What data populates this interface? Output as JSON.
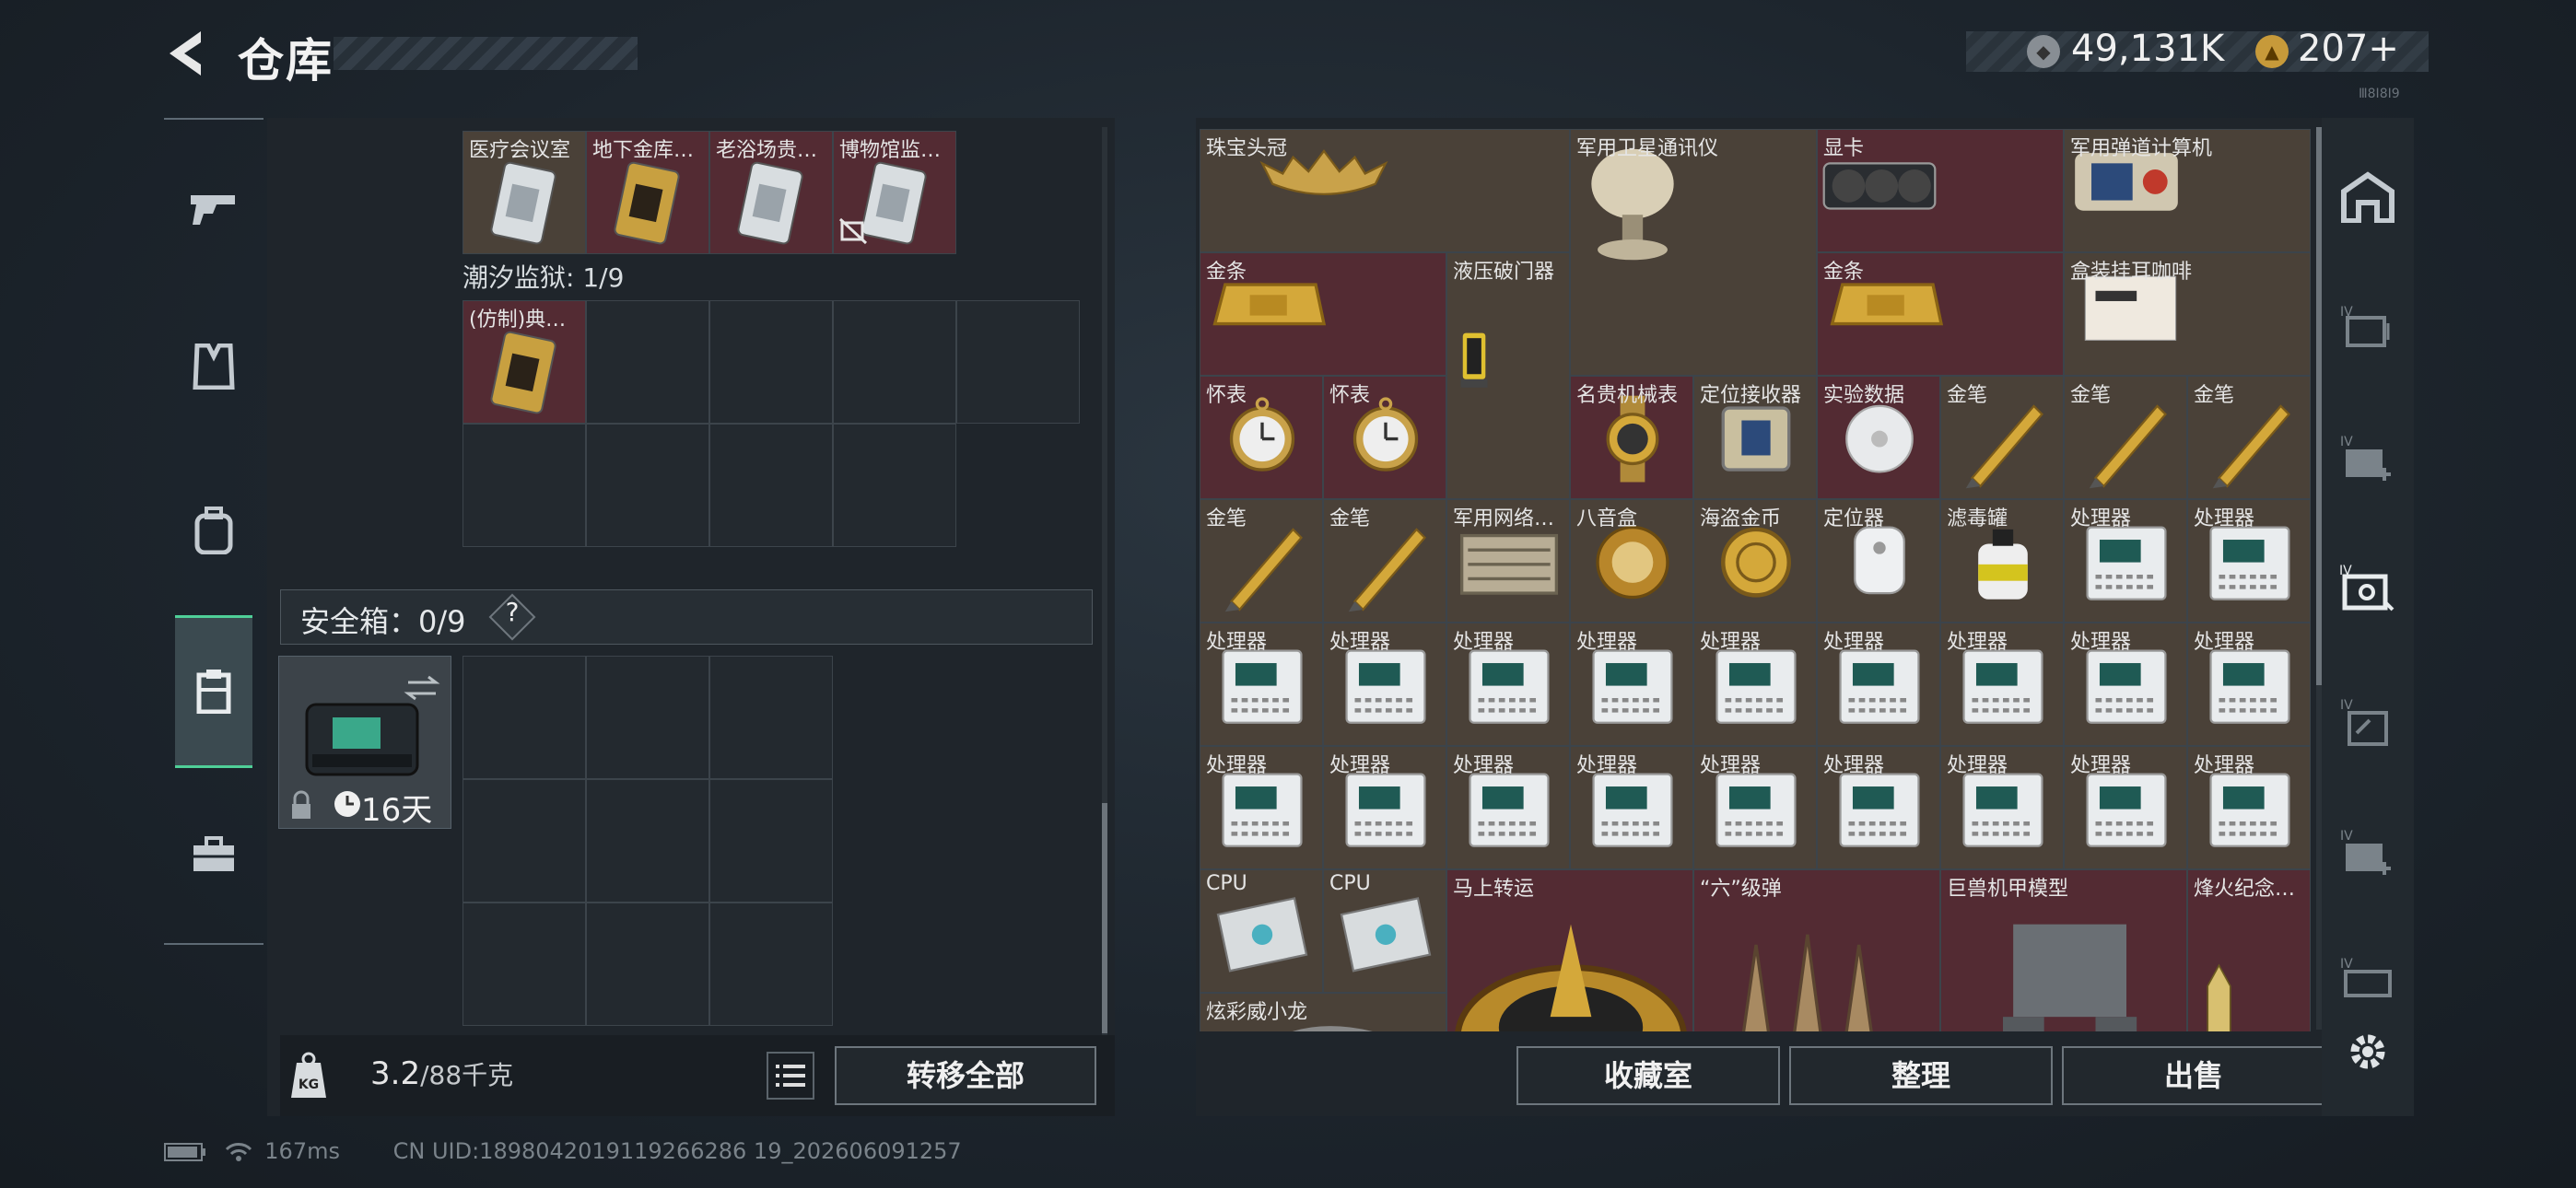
{
  "header": {
    "title": "仓库",
    "money": "49,131K",
    "gold": "207",
    "gold_plus": "+",
    "version": "Ⅲ8Ⅰ8Ⅰ9"
  },
  "left_nav": [
    "gun-icon",
    "vest-icon",
    "backpack-icon",
    "container-icon",
    "toolbox-icon"
  ],
  "top_row": [
    {
      "label": "医疗会议室",
      "color": "tan",
      "icon": "white-card-icon"
    },
    {
      "label": "地下金库…",
      "color": "red",
      "icon": "gold-card-icon"
    },
    {
      "label": "老浴场贵…",
      "color": "red",
      "icon": "white-card-icon"
    },
    {
      "label": "博物馆监…",
      "color": "red",
      "icon": "white-card-icon"
    }
  ],
  "tide": {
    "label": "潮汐监狱: 1/9",
    "item": "(仿制)典…"
  },
  "safe": {
    "label": "安全箱：0/9",
    "help": "?",
    "days": "16天"
  },
  "weight": {
    "current": "3.2",
    "max": "/88千克"
  },
  "buttons": {
    "transfer": "转移全部",
    "collection": "收藏室",
    "sort": "整理",
    "sell": "出售"
  },
  "status": {
    "ping": "167ms",
    "uid": "CN UID:1898042019119266286 19_202606091257"
  },
  "grid_items": [
    {
      "label": "珠宝头冠",
      "col": 0,
      "row": 0,
      "w": 3,
      "h": 1,
      "color": "tan",
      "icon": "crown"
    },
    {
      "label": "军用卫星通讯仪",
      "col": 3,
      "row": 0,
      "w": 2,
      "h": 2,
      "color": "tan",
      "icon": "satellite"
    },
    {
      "label": "显卡",
      "col": 5,
      "row": 0,
      "w": 2,
      "h": 1,
      "color": "red",
      "icon": "gpu"
    },
    {
      "label": "军用弹道计算机",
      "col": 7,
      "row": 0,
      "w": 2,
      "h": 1,
      "color": "tan",
      "icon": "computer"
    },
    {
      "label": "金条",
      "col": 0,
      "row": 1,
      "w": 2,
      "h": 1,
      "color": "red",
      "icon": "gold-bar"
    },
    {
      "label": "液压破门器",
      "col": 2,
      "row": 1,
      "w": 1,
      "h": 2,
      "color": "tan",
      "icon": "hydraulic"
    },
    {
      "label": "金条",
      "col": 5,
      "row": 1,
      "w": 2,
      "h": 1,
      "color": "red",
      "icon": "gold-bar"
    },
    {
      "label": "盒装挂耳咖啡",
      "col": 7,
      "row": 1,
      "w": 2,
      "h": 1,
      "color": "tan",
      "icon": "coffee"
    },
    {
      "label": "怀表",
      "col": 0,
      "row": 2,
      "w": 1,
      "h": 1,
      "color": "red",
      "icon": "watch"
    },
    {
      "label": "怀表",
      "col": 1,
      "row": 2,
      "w": 1,
      "h": 1,
      "color": "red",
      "icon": "watch"
    },
    {
      "label": "名贵机械表",
      "col": 3,
      "row": 2,
      "w": 1,
      "h": 1,
      "color": "red",
      "icon": "wristwatch"
    },
    {
      "label": "定位接收器",
      "col": 4,
      "row": 2,
      "w": 1,
      "h": 1,
      "color": "tan",
      "icon": "receiver"
    },
    {
      "label": "实验数据",
      "col": 5,
      "row": 2,
      "w": 1,
      "h": 1,
      "color": "red",
      "icon": "disc"
    },
    {
      "label": "金笔",
      "col": 6,
      "row": 2,
      "w": 1,
      "h": 1,
      "color": "tan",
      "icon": "pen"
    },
    {
      "label": "金笔",
      "col": 7,
      "row": 2,
      "w": 1,
      "h": 1,
      "color": "tan",
      "icon": "pen"
    },
    {
      "label": "金笔",
      "col": 8,
      "row": 2,
      "w": 1,
      "h": 1,
      "color": "tan",
      "icon": "pen"
    },
    {
      "label": "金笔",
      "col": 0,
      "row": 3,
      "w": 1,
      "h": 1,
      "color": "tan",
      "icon": "pen"
    },
    {
      "label": "金笔",
      "col": 1,
      "row": 3,
      "w": 1,
      "h": 1,
      "color": "tan",
      "icon": "pen"
    },
    {
      "label": "军用网络…",
      "col": 2,
      "row": 3,
      "w": 1,
      "h": 1,
      "color": "tan",
      "icon": "network"
    },
    {
      "label": "八音盒",
      "col": 3,
      "row": 3,
      "w": 1,
      "h": 1,
      "color": "tan",
      "icon": "musicbox"
    },
    {
      "label": "海盗金币",
      "col": 4,
      "row": 3,
      "w": 1,
      "h": 1,
      "color": "tan",
      "icon": "coin"
    },
    {
      "label": "定位器",
      "col": 5,
      "row": 3,
      "w": 1,
      "h": 1,
      "color": "tan",
      "icon": "locator"
    },
    {
      "label": "滤毒罐",
      "col": 6,
      "row": 3,
      "w": 1,
      "h": 1,
      "color": "tan",
      "icon": "canister"
    },
    {
      "label": "处理器",
      "col": 7,
      "row": 3,
      "w": 1,
      "h": 1,
      "color": "tan",
      "icon": "processor"
    },
    {
      "label": "处理器",
      "col": 8,
      "row": 3,
      "w": 1,
      "h": 1,
      "color": "tan",
      "icon": "processor"
    },
    {
      "label": "处理器",
      "col": 0,
      "row": 4,
      "w": 1,
      "h": 1,
      "color": "tan",
      "icon": "processor"
    },
    {
      "label": "处理器",
      "col": 1,
      "row": 4,
      "w": 1,
      "h": 1,
      "color": "tan",
      "icon": "processor"
    },
    {
      "label": "处理器",
      "col": 2,
      "row": 4,
      "w": 1,
      "h": 1,
      "color": "tan",
      "icon": "processor"
    },
    {
      "label": "处理器",
      "col": 3,
      "row": 4,
      "w": 1,
      "h": 1,
      "color": "tan",
      "icon": "processor"
    },
    {
      "label": "处理器",
      "col": 4,
      "row": 4,
      "w": 1,
      "h": 1,
      "color": "tan",
      "icon": "processor"
    },
    {
      "label": "处理器",
      "col": 5,
      "row": 4,
      "w": 1,
      "h": 1,
      "color": "tan",
      "icon": "processor"
    },
    {
      "label": "处理器",
      "col": 6,
      "row": 4,
      "w": 1,
      "h": 1,
      "color": "tan",
      "icon": "processor"
    },
    {
      "label": "处理器",
      "col": 7,
      "row": 4,
      "w": 1,
      "h": 1,
      "color": "tan",
      "icon": "processor"
    },
    {
      "label": "处理器",
      "col": 8,
      "row": 4,
      "w": 1,
      "h": 1,
      "color": "tan",
      "icon": "processor"
    },
    {
      "label": "处理器",
      "col": 0,
      "row": 5,
      "w": 1,
      "h": 1,
      "color": "tan",
      "icon": "processor"
    },
    {
      "label": "处理器",
      "col": 1,
      "row": 5,
      "w": 1,
      "h": 1,
      "color": "tan",
      "icon": "processor"
    },
    {
      "label": "处理器",
      "col": 2,
      "row": 5,
      "w": 1,
      "h": 1,
      "color": "tan",
      "icon": "processor"
    },
    {
      "label": "处理器",
      "col": 3,
      "row": 5,
      "w": 1,
      "h": 1,
      "color": "tan",
      "icon": "processor"
    },
    {
      "label": "处理器",
      "col": 4,
      "row": 5,
      "w": 1,
      "h": 1,
      "color": "tan",
      "icon": "processor"
    },
    {
      "label": "处理器",
      "col": 5,
      "row": 5,
      "w": 1,
      "h": 1,
      "color": "tan",
      "icon": "processor"
    },
    {
      "label": "处理器",
      "col": 6,
      "row": 5,
      "w": 1,
      "h": 1,
      "color": "tan",
      "icon": "processor"
    },
    {
      "label": "处理器",
      "col": 7,
      "row": 5,
      "w": 1,
      "h": 1,
      "color": "tan",
      "icon": "processor"
    },
    {
      "label": "处理器",
      "col": 8,
      "row": 5,
      "w": 1,
      "h": 1,
      "color": "tan",
      "icon": "processor"
    },
    {
      "label": "CPU",
      "col": 0,
      "row": 6,
      "w": 1,
      "h": 1,
      "color": "tan",
      "icon": "cpu"
    },
    {
      "label": "CPU",
      "col": 1,
      "row": 6,
      "w": 1,
      "h": 1,
      "color": "tan",
      "icon": "cpu"
    },
    {
      "label": "马上转运",
      "col": 2,
      "row": 6,
      "w": 2,
      "h": 2,
      "color": "red",
      "icon": "horse-disc"
    },
    {
      "label": "“六”级弹",
      "col": 4,
      "row": 6,
      "w": 2,
      "h": 2,
      "color": "red",
      "icon": "bullets"
    },
    {
      "label": "巨兽机甲模型",
      "col": 6,
      "row": 6,
      "w": 2,
      "h": 2,
      "color": "red",
      "icon": "mech"
    },
    {
      "label": "烽火纪念…",
      "col": 8,
      "row": 6,
      "w": 1,
      "h": 2,
      "color": "red",
      "icon": "trophy"
    },
    {
      "label": "炫彩威小龙",
      "col": 0,
      "row": 7,
      "w": 2,
      "h": 1,
      "color": "tan",
      "icon": "dragon"
    }
  ],
  "right_nav": [
    "vault-icon",
    "card-case-icon",
    "medkit-icon",
    "keycard-icon",
    "key-icon",
    "medkit-icon-2",
    "ticket-icon",
    "settings-icon"
  ]
}
